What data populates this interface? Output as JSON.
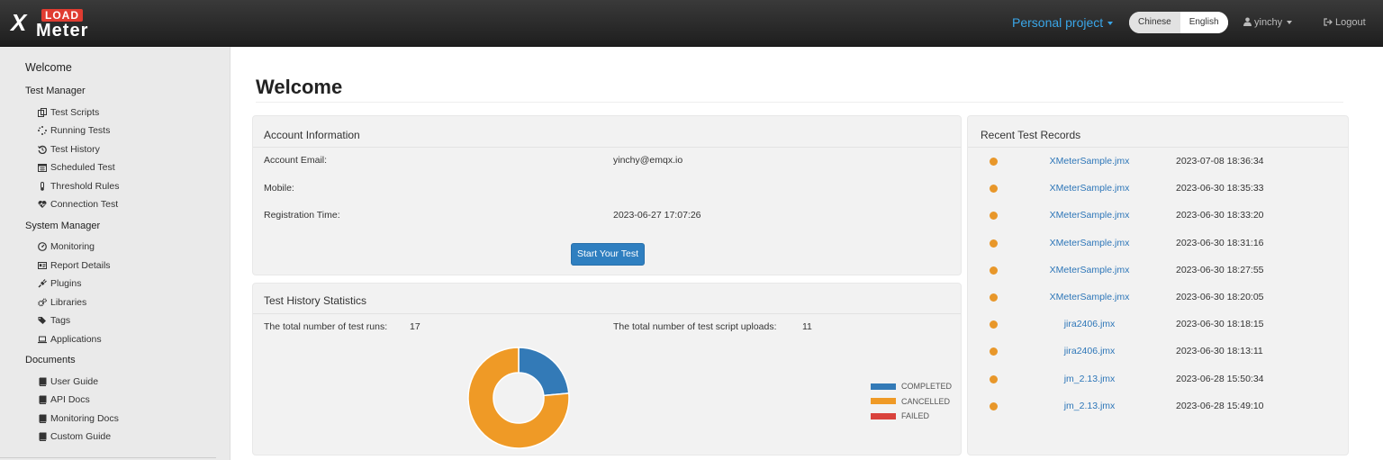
{
  "header": {
    "logo_load": "LOAD",
    "logo_x": "X",
    "logo_meter": "Meter",
    "project": "Personal project",
    "languages": [
      "Chinese",
      "English"
    ],
    "user": "yinchy",
    "logout": "Logout",
    "accent_color": "#3aa6e8"
  },
  "sidebar": {
    "welcome": "Welcome",
    "sections": [
      {
        "title": "Test Manager",
        "items": [
          {
            "label": "Test Scripts",
            "icon": "copy-icon"
          },
          {
            "label": "Running Tests",
            "icon": "spinner-icon"
          },
          {
            "label": "Test History",
            "icon": "history-icon"
          },
          {
            "label": "Scheduled Test",
            "icon": "calendar-icon"
          },
          {
            "label": "Threshold Rules",
            "icon": "thermometer-icon"
          },
          {
            "label": "Connection Test",
            "icon": "heartbeat-icon"
          }
        ]
      },
      {
        "title": "System Manager",
        "items": [
          {
            "label": "Monitoring",
            "icon": "dashboard-icon"
          },
          {
            "label": "Report Details",
            "icon": "id-card-icon"
          },
          {
            "label": "Plugins",
            "icon": "plug-icon"
          },
          {
            "label": "Libraries",
            "icon": "cogs-icon"
          },
          {
            "label": "Tags",
            "icon": "tags-icon"
          },
          {
            "label": "Applications",
            "icon": "laptop-icon"
          }
        ]
      },
      {
        "title": "Documents",
        "items": [
          {
            "label": "User Guide",
            "icon": "book-icon"
          },
          {
            "label": "API Docs",
            "icon": "book-icon"
          },
          {
            "label": "Monitoring Docs",
            "icon": "book-icon"
          },
          {
            "label": "Custom Guide",
            "icon": "book-icon"
          }
        ]
      }
    ]
  },
  "main": {
    "title": "Welcome",
    "account": {
      "title": "Account Information",
      "rows": [
        {
          "label": "Account Email:",
          "value": "yinchy@emqx.io"
        },
        {
          "label": "Mobile:",
          "value": ""
        },
        {
          "label": "Registration Time:",
          "value": "2023-06-27 17:07:26"
        }
      ],
      "start_button": "Start Your Test"
    },
    "stats": {
      "title": "Test History Statistics",
      "runs_label": "The total number of test runs:",
      "runs_value": "17",
      "uploads_label": "The total number of test script uploads:",
      "uploads_value": "11"
    },
    "recent": {
      "title": "Recent Test Records",
      "records": [
        {
          "file": "XMeterSample.jmx",
          "time": "2023-07-08 18:36:34"
        },
        {
          "file": "XMeterSample.jmx",
          "time": "2023-06-30 18:35:33"
        },
        {
          "file": "XMeterSample.jmx",
          "time": "2023-06-30 18:33:20"
        },
        {
          "file": "XMeterSample.jmx",
          "time": "2023-06-30 18:31:16"
        },
        {
          "file": "XMeterSample.jmx",
          "time": "2023-06-30 18:27:55"
        },
        {
          "file": "XMeterSample.jmx",
          "time": "2023-06-30 18:20:05"
        },
        {
          "file": "jira2406.jmx",
          "time": "2023-06-30 18:18:15"
        },
        {
          "file": "jira2406.jmx",
          "time": "2023-06-30 18:13:11"
        },
        {
          "file": "jm_2.13.jmx",
          "time": "2023-06-28 15:50:34"
        },
        {
          "file": "jm_2.13.jmx",
          "time": "2023-06-28 15:49:10"
        }
      ],
      "dot_color": "#e8972a"
    }
  },
  "chart_data": {
    "type": "pie",
    "donut": true,
    "categories": [
      "COMPLETED",
      "CANCELLED",
      "FAILED"
    ],
    "values": [
      4,
      13,
      0
    ],
    "colors": [
      "#337ab7",
      "#ef9a26",
      "#d9423c"
    ],
    "legend": "right"
  }
}
